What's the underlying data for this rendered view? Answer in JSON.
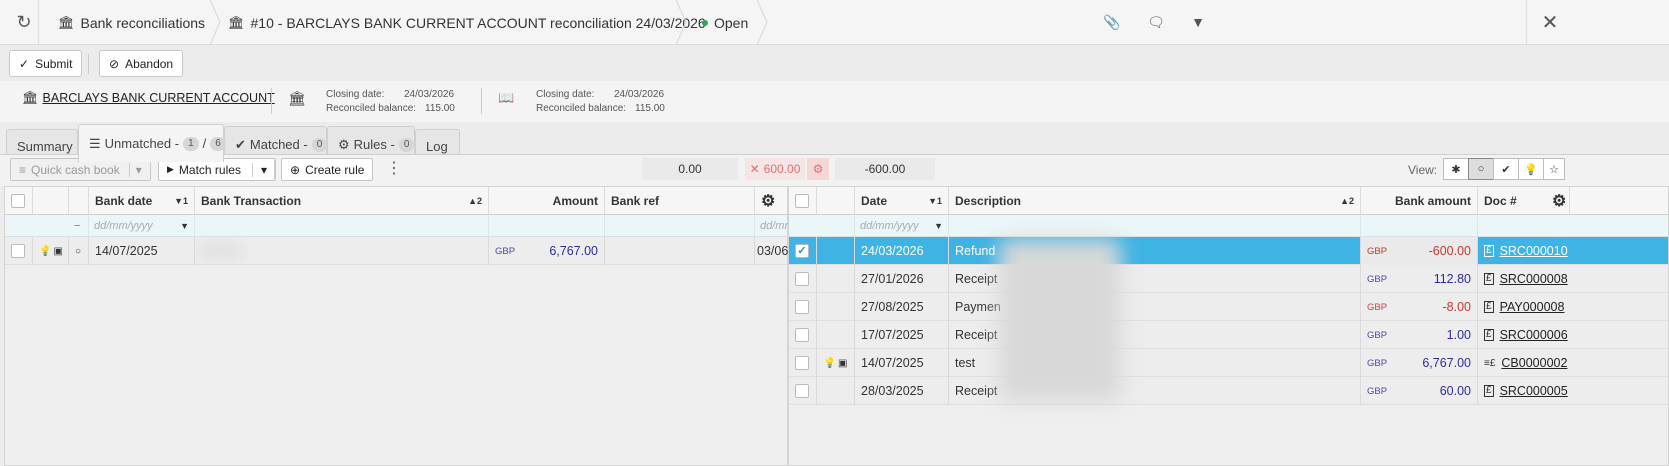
{
  "breadcrumbs": {
    "list": "Bank reconciliations",
    "title": "#10 - BARCLAYS BANK CURRENT ACCOUNT reconciliation 24/03/2026",
    "status": "Open"
  },
  "toolbar": {
    "submit": "Submit",
    "abandon": "Abandon"
  },
  "account": {
    "name": "BARCLAYS BANK CURRENT ACCOUNT",
    "bank": {
      "closing_label": "Closing date:",
      "closing": "24/03/2026",
      "balance_label": "Reconciled balance:",
      "balance": "115.00"
    },
    "book": {
      "closing_label": "Closing date:",
      "closing": "24/03/2026",
      "balance_label": "Reconciled balance:",
      "balance": "115.00"
    }
  },
  "tabs": {
    "summary": "Summary",
    "unmatched": "Unmatched -",
    "unmatched_count_a": "1",
    "unmatched_sep": "/",
    "unmatched_count_b": "6",
    "matched": "Matched -",
    "matched_count": "0",
    "rules": "Rules -",
    "rules_count": "0",
    "log": "Log"
  },
  "actions": {
    "quick_cash_book": "Quick cash book",
    "match_rules": "Match rules",
    "create_rule": "Create rule"
  },
  "totals": {
    "left": "0.00",
    "diff": "600.00",
    "right": "-600.00"
  },
  "view_label": "View:",
  "left": {
    "headers": {
      "bank_date": "Bank date",
      "bank_date_sort": "1",
      "transaction": "Bank Transaction",
      "transaction_sort": "2",
      "amount": "Amount",
      "bank_ref": "Bank ref"
    },
    "date_placeholder": "dd/mm/yyyy",
    "rows": [
      {
        "date": "14/07/2025",
        "currency": "GBP",
        "amount": "6,767.00",
        "extra": "03/06"
      }
    ]
  },
  "right": {
    "headers": {
      "date": "Date",
      "date_sort": "1",
      "description": "Description",
      "description_sort": "2",
      "bank_amount": "Bank amount",
      "doc": "Doc #"
    },
    "date_placeholder": "dd/mm/yyyy",
    "rows": [
      {
        "date": "24/03/2026",
        "desc": "Refund",
        "currency": "GBP",
        "amount": "-600.00",
        "doc": "SRC000010",
        "neg": true,
        "selected": true,
        "type": "sales"
      },
      {
        "date": "27/01/2026",
        "desc": "Receipt",
        "currency": "GBP",
        "amount": "112.80",
        "doc": "SRC000008",
        "neg": false,
        "type": "sales"
      },
      {
        "date": "27/08/2025",
        "desc": "Paymen",
        "currency": "GBP",
        "amount": "-8.00",
        "doc": "PAY000008",
        "neg": true,
        "type": "sales"
      },
      {
        "date": "17/07/2025",
        "desc": "Receipt",
        "currency": "GBP",
        "amount": "1.00",
        "doc": "SRC000006",
        "neg": false,
        "type": "sales"
      },
      {
        "date": "14/07/2025",
        "desc": "test",
        "currency": "GBP",
        "amount": "6,767.00",
        "doc": "CB0000002",
        "neg": false,
        "type": "cash"
      },
      {
        "date": "28/03/2025",
        "desc": "Receipt",
        "currency": "GBP",
        "amount": "60.00",
        "doc": "SRC000005",
        "neg": false,
        "type": "sales"
      }
    ]
  },
  "colors": {
    "accent": "#3fb3e3",
    "negative": "#c8362e",
    "positive": "#2d2d9a",
    "open": "#2fa84f"
  }
}
